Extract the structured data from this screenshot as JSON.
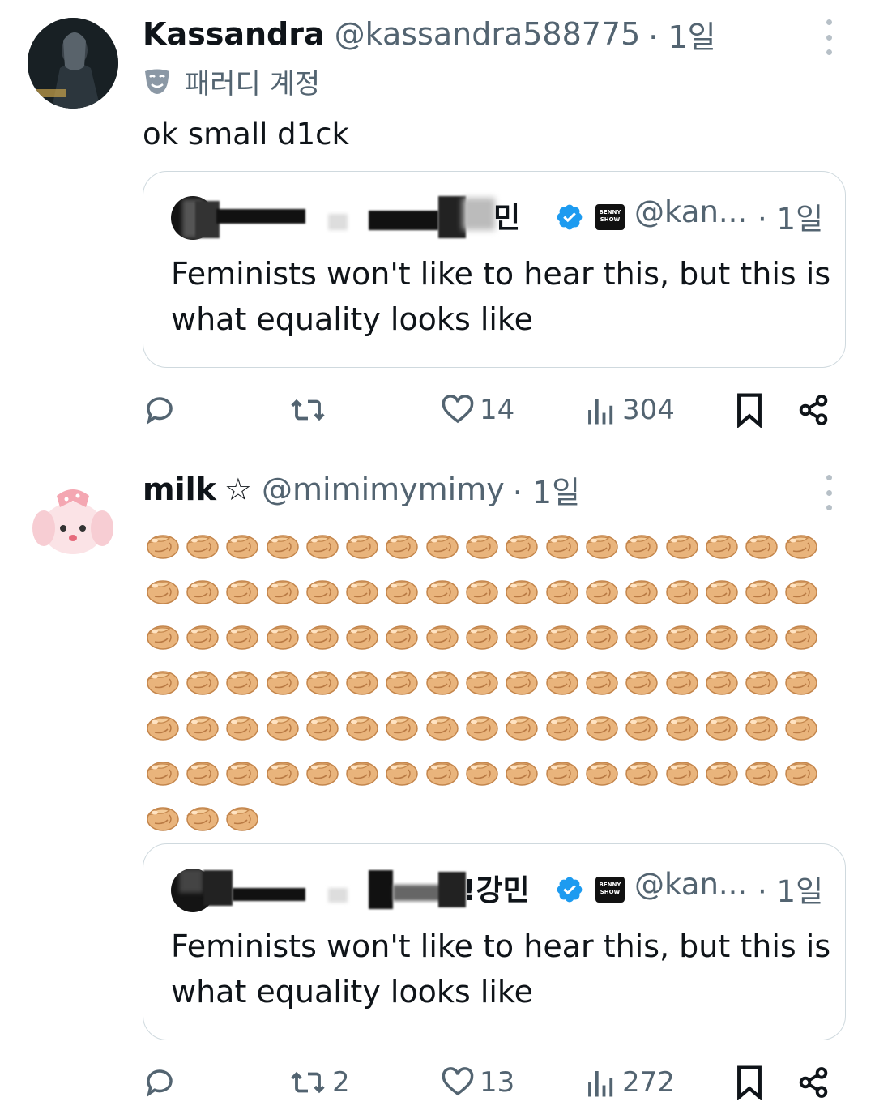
{
  "tweets": [
    {
      "author_name": "Kassandra",
      "handle": "@kassandra588775",
      "time": "· 1일",
      "parody_label": "패러디 계정",
      "text": "ok small d1ck",
      "quote": {
        "name_suffix": "민",
        "handle": "@kan...",
        "time": "· 1일",
        "text": "Feminists won't like to hear this, but this is what equality looks like",
        "affiliate_badge": "BENNY SHOW"
      },
      "stats": {
        "replies": "",
        "reposts": "",
        "likes": "14",
        "views": "304"
      }
    },
    {
      "author_name": "milk",
      "name_symbol": "☆",
      "handle": "@mimimymimy",
      "time": "· 1일",
      "emoji_rows": 7,
      "emoji_count": 105,
      "emoji_icon": "pinching-hand-emoji",
      "quote": {
        "name_suffix": "!강민",
        "handle": "@kan...",
        "time": "· 1일",
        "text": "Feminists won't like to hear this, but this is what equality looks like",
        "affiliate_badge": "BENNY SHOW"
      },
      "stats": {
        "replies": "",
        "reposts": "2",
        "likes": "13",
        "views": "272"
      }
    }
  ],
  "colors": {
    "text": "#0f1419",
    "secondary": "#536471",
    "verified": "#1d9bf0",
    "border": "#cfd9de"
  }
}
